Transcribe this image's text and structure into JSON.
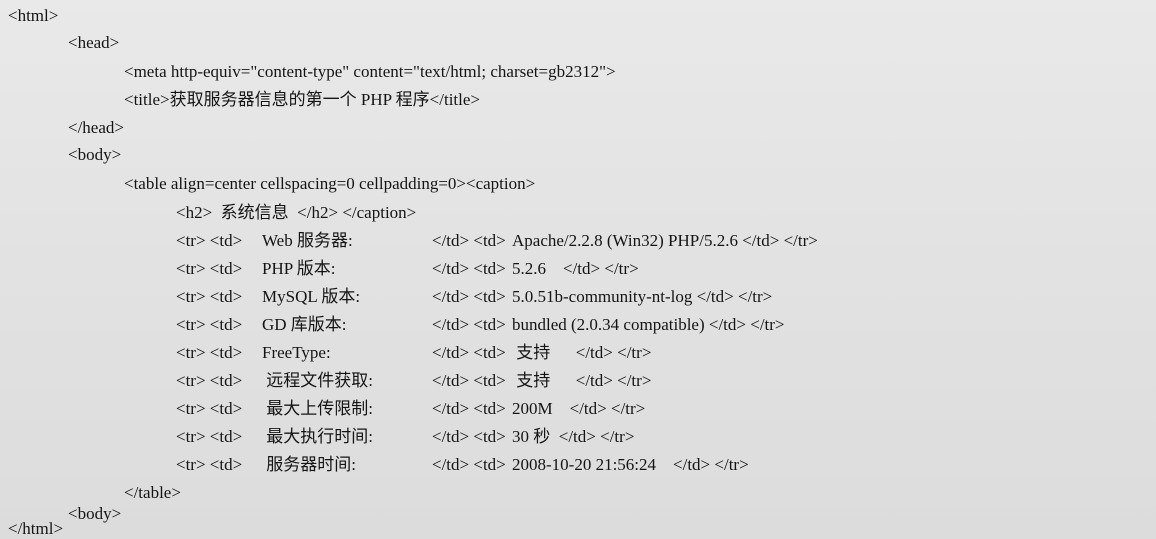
{
  "lines": {
    "html_open": "<html>",
    "head_open": "<head>",
    "meta": "<meta http-equiv=\"content-type\" content=\"text/html; charset=gb2312\">",
    "title": "<title>获取服务器信息的第一个 PHP 程序</title>",
    "head_close": "</head>",
    "body_open": "<body>",
    "table_open": "<table align=center cellspacing=0 cellpadding=0><caption>",
    "caption": "<h2>  系统信息  </h2> </caption>",
    "table_close": "</table>",
    "body_close": "<body>",
    "html_close": "</html>"
  },
  "rows": [
    {
      "open": "<tr> <td>",
      "label": "Web 服务器:",
      "mid": "</td> <td>",
      "value": "Apache/2.2.8 (Win32) PHP/5.2.6 </td> </tr>"
    },
    {
      "open": "<tr> <td>",
      "label": "PHP 版本:",
      "mid": "</td> <td>",
      "value": "5.2.6    </td> </tr>"
    },
    {
      "open": "<tr> <td>",
      "label": "MySQL 版本:",
      "mid": "</td> <td>",
      "value": "5.0.51b-community-nt-log </td> </tr>"
    },
    {
      "open": "<tr> <td>",
      "label": "GD 库版本:",
      "mid": "</td> <td>",
      "value": "bundled (2.0.34 compatible) </td> </tr>"
    },
    {
      "open": "<tr> <td>",
      "label": "FreeType:",
      "mid": "</td> <td>",
      "value": " 支持      </td> </tr>"
    },
    {
      "open": "<tr> <td>",
      "label": " 远程文件获取:",
      "mid": "</td> <td>",
      "value": " 支持      </td> </tr>"
    },
    {
      "open": "<tr> <td>",
      "label": " 最大上传限制:",
      "mid": "</td> <td>",
      "value": "200M    </td> </tr>"
    },
    {
      "open": "<tr> <td>",
      "label": " 最大执行时间:",
      "mid": "</td> <td>",
      "value": "30 秒  </td> </tr>"
    },
    {
      "open": "<tr> <td>",
      "label": " 服务器时间:",
      "mid": "</td> <td>",
      "value": "2008-10-20 21:56:24    </td> </tr>"
    }
  ]
}
